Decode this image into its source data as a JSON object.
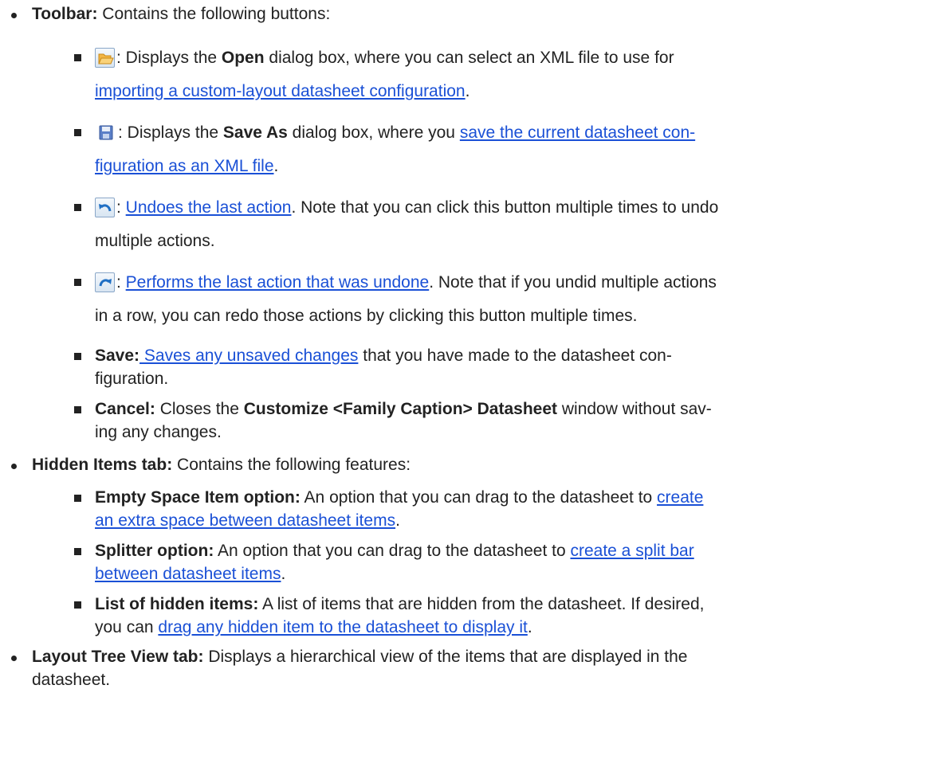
{
  "items": [
    {
      "label": "Toolbar:",
      "text": " Contains the following buttons:",
      "children": [
        {
          "icon": "open-folder-icon",
          "text_before": ": Displays the ",
          "bold": "Open",
          "text_mid": " dialog box, where you can select an XML file to use for",
          "link_line2": "importing a custom-layout datasheet configuration",
          "text_end": "."
        },
        {
          "icon": "save-disk-icon",
          "text_before": ": Displays the ",
          "bold": "Save As",
          "text_mid": " dialog box, where you ",
          "link_a": "save the current datasheet con-",
          "link_b": "figuration as an XML file",
          "text_end": "."
        },
        {
          "icon": "undo-icon",
          "text_before": ": ",
          "link": "Undoes the last action",
          "text_after": ". Note that you can click this button multiple times to undo",
          "line2": "multiple actions."
        },
        {
          "icon": "redo-icon",
          "text_before": ": ",
          "link": "Performs the last action that was undone",
          "text_after": ". Note that if you undid multiple actions",
          "line2": "in a row, you can redo those actions by clicking this button multiple times."
        },
        {
          "bold": "Save:",
          "link": " Saves any unsaved changes",
          "text_after": " that you have made to the datasheet con-",
          "line2": "figuration."
        },
        {
          "bold": "Cancel:",
          "text_a": " Closes the ",
          "bold2": "Customize <Family Caption> Datasheet",
          "text_b": " window without sav-",
          "line2": "ing any changes."
        }
      ]
    },
    {
      "label": "Hidden Items tab:",
      "text": " Contains the following features:",
      "children": [
        {
          "bold": "Empty Space Item option:",
          "text": " An option that you can drag to the datasheet to ",
          "link_a": "create ",
          "link_b": "an extra space between datasheet items",
          "text_end": "."
        },
        {
          "bold": "Splitter option:",
          "text": " An option that you can drag to the datasheet to ",
          "link_a": "create a split bar ",
          "link_b": "between datasheet items",
          "text_end": "."
        },
        {
          "bold": "List of hidden items:",
          "text": " A list of items that are hidden from the datasheet. If desired,",
          "text2": "you can ",
          "link": "drag any hidden item to the datasheet to display it",
          "text_end": "."
        }
      ]
    },
    {
      "label": "Layout Tree View tab:",
      "text": " Displays a hierarchical view of the items that are displayed in the",
      "line2": "datasheet."
    }
  ],
  "colors": {
    "link": "#1a50d6",
    "text": "#222222"
  }
}
